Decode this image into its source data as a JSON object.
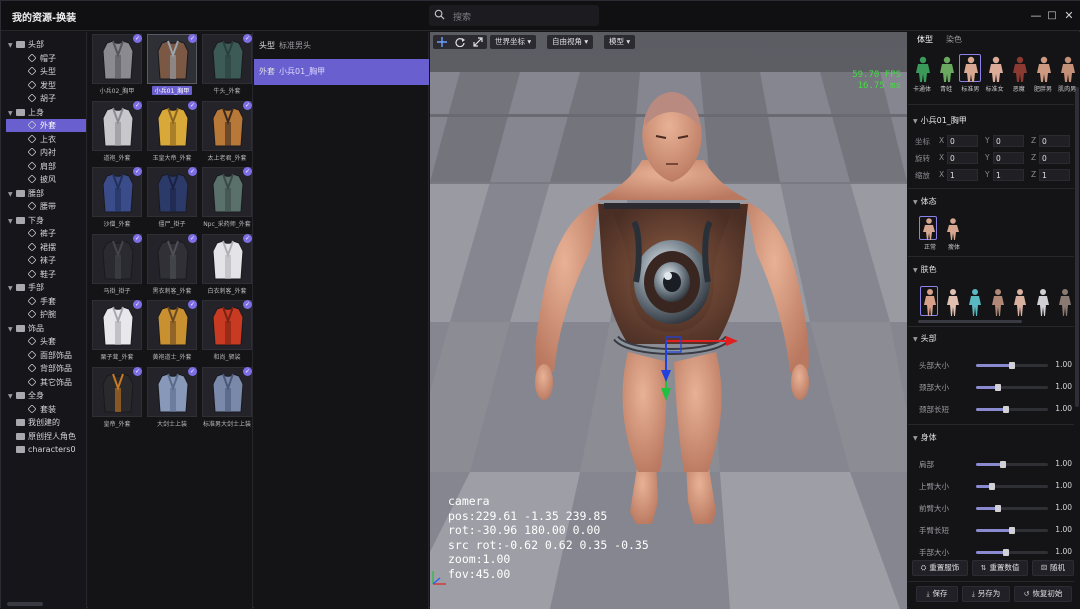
{
  "window": {
    "title": "我的资源-换装",
    "search_placeholder": "搜索",
    "controls": [
      "—",
      "□",
      "✕"
    ]
  },
  "tree": {
    "items": [
      {
        "label": "头部",
        "level": 0,
        "type": "folder",
        "expanded": true
      },
      {
        "label": "帽子",
        "level": 1,
        "type": "item"
      },
      {
        "label": "头型",
        "level": 1,
        "type": "item"
      },
      {
        "label": "发型",
        "level": 1,
        "type": "item"
      },
      {
        "label": "胡子",
        "level": 1,
        "type": "item"
      },
      {
        "label": "上身",
        "level": 0,
        "type": "folder",
        "expanded": true
      },
      {
        "label": "外套",
        "level": 1,
        "type": "item",
        "selected": true
      },
      {
        "label": "上衣",
        "level": 1,
        "type": "item"
      },
      {
        "label": "内衬",
        "level": 1,
        "type": "item"
      },
      {
        "label": "肩部",
        "level": 1,
        "type": "item"
      },
      {
        "label": "披风",
        "level": 1,
        "type": "item"
      },
      {
        "label": "腰部",
        "level": 0,
        "type": "folder",
        "expanded": true
      },
      {
        "label": "腰带",
        "level": 1,
        "type": "item"
      },
      {
        "label": "下身",
        "level": 0,
        "type": "folder",
        "expanded": true
      },
      {
        "label": "裤子",
        "level": 1,
        "type": "item"
      },
      {
        "label": "裙摆",
        "level": 1,
        "type": "item"
      },
      {
        "label": "袜子",
        "level": 1,
        "type": "item"
      },
      {
        "label": "鞋子",
        "level": 1,
        "type": "item"
      },
      {
        "label": "手部",
        "level": 0,
        "type": "folder",
        "expanded": true
      },
      {
        "label": "手套",
        "level": 1,
        "type": "item"
      },
      {
        "label": "护腕",
        "level": 1,
        "type": "item"
      },
      {
        "label": "饰品",
        "level": 0,
        "type": "folder",
        "expanded": true
      },
      {
        "label": "头套",
        "level": 1,
        "type": "item"
      },
      {
        "label": "面部饰品",
        "level": 1,
        "type": "item"
      },
      {
        "label": "背部饰品",
        "level": 1,
        "type": "item"
      },
      {
        "label": "其它饰品",
        "level": 1,
        "type": "item"
      },
      {
        "label": "全身",
        "level": 0,
        "type": "folder",
        "expanded": true
      },
      {
        "label": "套装",
        "level": 1,
        "type": "item"
      },
      {
        "label": "我创建的",
        "level": 0,
        "type": "folder",
        "expanded": false
      },
      {
        "label": "原创捏人角色",
        "level": 0,
        "type": "folder",
        "expanded": false
      },
      {
        "label": "characters0",
        "level": 0,
        "type": "folder",
        "expanded": false
      }
    ]
  },
  "assets": [
    {
      "label": "小兵02_胸甲",
      "checked": true,
      "color": "#8a8a90",
      "accent": "#55555c"
    },
    {
      "label": "小兵01_胸甲",
      "checked": true,
      "selected": true,
      "color": "#7a5844",
      "accent": "#9aa4ae"
    },
    {
      "label": "牛头_外套",
      "checked": true,
      "color": "#3c5a56",
      "accent": "#2a403d"
    },
    {
      "label": "道袍_外套",
      "checked": true,
      "color": "#c8c8cc",
      "accent": "#8a8a90"
    },
    {
      "label": "玉皇大帝_外套",
      "checked": true,
      "color": "#d8a838",
      "accent": "#8a6420"
    },
    {
      "label": "太上老君_外套",
      "checked": true,
      "color": "#b87838",
      "accent": "#3a2a20"
    },
    {
      "label": "沙僧_外套",
      "checked": true,
      "color": "#3a4c8a",
      "accent": "#22305a"
    },
    {
      "label": "僵尸_褂子",
      "checked": true,
      "color": "#2c3a6a",
      "accent": "#1a2244"
    },
    {
      "label": "Npc_采药师_外套",
      "checked": true,
      "color": "#5a706a",
      "accent": "#3c4a46"
    },
    {
      "label": "马褂_褂子",
      "checked": true,
      "color": "#2a2a30",
      "accent": "#44444c"
    },
    {
      "label": "黑衣刺客_外套",
      "checked": true,
      "color": "#303036",
      "accent": "#505058"
    },
    {
      "label": "白衣刺客_外套",
      "checked": true,
      "color": "#e4e4e8",
      "accent": "#b0b0b6"
    },
    {
      "label": "栗子茸_外套",
      "checked": true,
      "color": "#e8e8ec",
      "accent": "#a8a8ae"
    },
    {
      "label": "黄袍道士_外套",
      "checked": true,
      "color": "#c89030",
      "accent": "#6a4a22"
    },
    {
      "label": "和尚_袈裟",
      "checked": true,
      "color": "#c83a22",
      "accent": "#7a2214"
    },
    {
      "label": "皇帝_外套",
      "checked": true,
      "color": "#2a2a2c",
      "accent": "#c87820"
    },
    {
      "label": "大剑士上装",
      "checked": true,
      "color": "#8898b8",
      "accent": "#5a6a8a"
    },
    {
      "label": "标准男大剑士上装",
      "checked": true,
      "color": "#7a88aa",
      "accent": "#4a5878"
    }
  ],
  "equipped": [
    {
      "slot": "头型",
      "item": "标准男头",
      "selected": false
    },
    {
      "slot": "外套",
      "item": "小兵01_胸甲",
      "selected": true
    }
  ],
  "viewport": {
    "move_icon": "move-icon",
    "rotate_icon": "rotate-icon",
    "scale_icon": "scale-icon",
    "coord_space": "世界坐标",
    "view_mode": "自由视角",
    "render_mode": "模型",
    "fps": "59.70 FPS",
    "frame_time": "16.75 ms",
    "camera_text": "camera\npos:229.61 -1.35 239.85\nrot:-30.96 180.00 0.00\nsrc rot:-0.62 0.62 0.35 -0.35\nzoom:1.00\nfov:45.00"
  },
  "right_panel": {
    "tabs": [
      "体型",
      "染色"
    ],
    "body_types": [
      {
        "label": "卡通体",
        "color": "#3a9a5a"
      },
      {
        "label": "青蛙",
        "color": "#6aa860"
      },
      {
        "label": "标准男",
        "color": "#d8a890",
        "selected": true
      },
      {
        "label": "标准女",
        "color": "#dcac98"
      },
      {
        "label": "恶魔",
        "color": "#8a3a30"
      },
      {
        "label": "肥胖男",
        "color": "#cc9a80"
      },
      {
        "label": "肌肉男",
        "color": "#c49078"
      }
    ],
    "object_name": "小兵01_胸甲",
    "transform": {
      "rows": [
        {
          "label": "坐标",
          "x": "0",
          "y": "0",
          "z": "0"
        },
        {
          "label": "旋转",
          "x": "0",
          "y": "0",
          "z": "0"
        },
        {
          "label": "缩放",
          "x": "1",
          "y": "1",
          "z": "1"
        }
      ],
      "axes": [
        "X",
        "Y",
        "Z"
      ]
    },
    "posture": {
      "title": "体态",
      "items": [
        {
          "label": "正常",
          "selected": true
        },
        {
          "label": "瘦体"
        }
      ]
    },
    "skin": {
      "title": "肤色",
      "colors": [
        "#d8a088",
        "#e0c0b0",
        "#5ab8c0",
        "#b08878",
        "#d8b0a0",
        "#cfcfd4",
        "#8a7a72",
        "#d8c0b0"
      ]
    },
    "head": {
      "title": "头部",
      "sliders": [
        {
          "label": "头部大小",
          "value": "1.00",
          "level": 0.5
        },
        {
          "label": "颈部大小",
          "value": "1.00",
          "level": 0.3
        },
        {
          "label": "颈部长短",
          "value": "1.00",
          "level": 0.42
        }
      ]
    },
    "body": {
      "title": "身体",
      "sliders": [
        {
          "label": "肩部",
          "value": "1.00",
          "level": 0.38
        },
        {
          "label": "上臂大小",
          "value": "1.00",
          "level": 0.22
        },
        {
          "label": "前臂大小",
          "value": "1.00",
          "level": 0.3
        },
        {
          "label": "手臂长短",
          "value": "1.00",
          "level": 0.5
        },
        {
          "label": "手部大小",
          "value": "1.00",
          "level": 0.42
        }
      ]
    },
    "actions1": [
      "重置服饰",
      "重置数值",
      "随机"
    ],
    "actions2": [
      "保存",
      "另存为",
      "恢复初始"
    ]
  },
  "colors": {
    "accent": "#6a5fcf",
    "check": "#7d6ee6",
    "fps": "#3ee03e"
  }
}
